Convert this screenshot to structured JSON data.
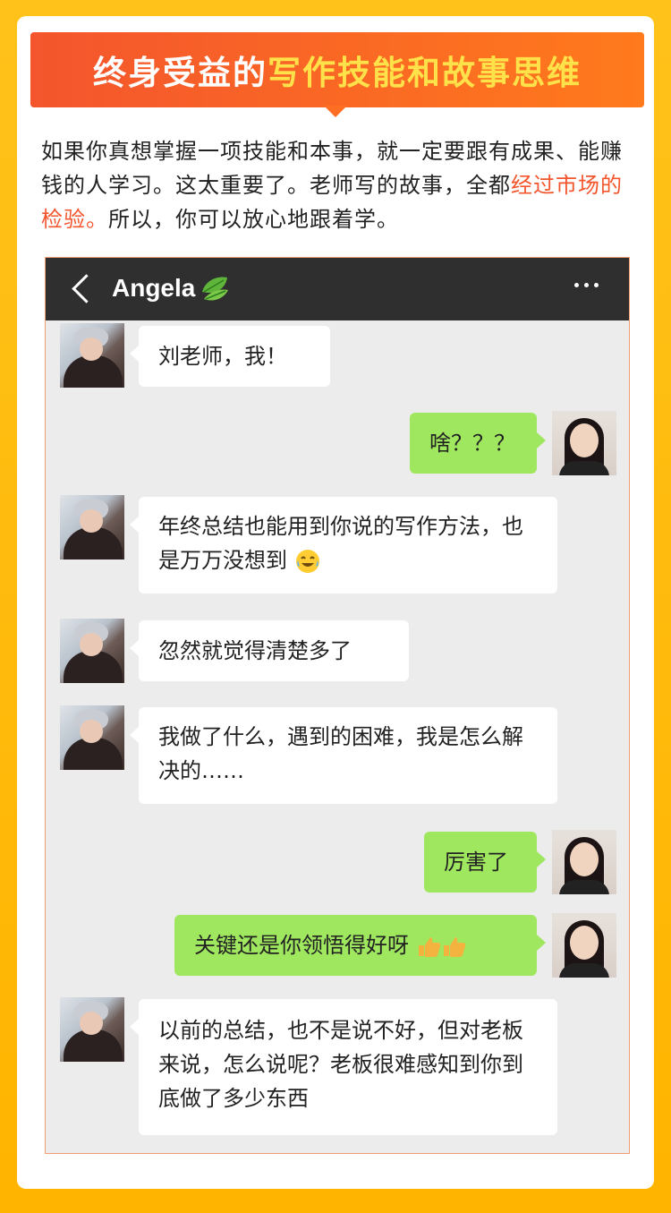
{
  "banner": {
    "part1": "终身受益的",
    "part2": "写作技能和故事思维"
  },
  "intro": {
    "line_a": "如果你真想掌握一项技能和本事，就一定要跟有成果、能赚钱的人学习。这太重要了。老师写的故事，全都",
    "highlight": "经过市场的检验。",
    "line_b": "所以，你可以放心地跟着学。"
  },
  "chat": {
    "contact_name": "Angela",
    "back_icon": "chevron-left-icon",
    "more_icon": "more-dots-icon",
    "title_icon": "leaf-emoji-icon",
    "colors": {
      "topbar": "#2f2f2f",
      "background": "#ececec",
      "outgoing": "#9fe75f",
      "incoming": "#ffffff"
    },
    "messages": [
      {
        "side": "left",
        "text": "刘老师，我！"
      },
      {
        "side": "right",
        "text": "啥？？？"
      },
      {
        "side": "left",
        "text": "年终总结也能用到你说的写作方法，也是万万没想到",
        "emoji": "crying-laughing-emoji"
      },
      {
        "side": "left",
        "text": "忽然就觉得清楚多了"
      },
      {
        "side": "left",
        "text": "我做了什么，遇到的困难，我是怎么解决的……"
      },
      {
        "side": "right",
        "text": "厉害了"
      },
      {
        "side": "right",
        "text": "关键还是你领悟得好呀",
        "emoji": "thumbs-up-emoji"
      },
      {
        "side": "left",
        "text": "以前的总结，也不是说不好，但对老板来说，怎么说呢？老板很难感知到你到底做了多少东西"
      }
    ]
  }
}
